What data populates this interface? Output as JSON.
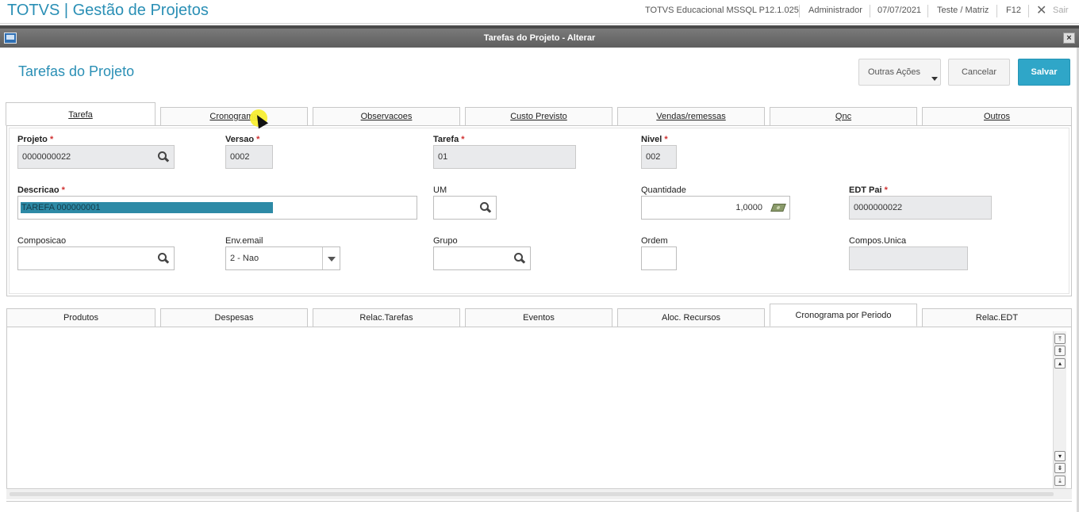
{
  "app": {
    "title": "TOTVS | Gestão de Projetos",
    "environment": "TOTVS Educacional MSSQL P12.1.025",
    "user": "Administrador",
    "date": "07/07/2021",
    "branch": "Teste / Matriz",
    "help_key": "F12",
    "exit_label": "Sair"
  },
  "window": {
    "title": "Tarefas do Projeto - Alterar",
    "close_glyph": "×"
  },
  "page": {
    "title": "Tarefas do Projeto"
  },
  "actions": {
    "more": "Outras Ações",
    "cancel": "Cancelar",
    "save": "Salvar"
  },
  "top_tabs": [
    "Tarefa",
    "Cronograma",
    "Observacoes",
    "Custo Previsto",
    "Vendas/remessas",
    "Qnc",
    "Outros"
  ],
  "form": {
    "projeto": {
      "label": "Projeto",
      "value": "0000000022"
    },
    "versao": {
      "label": "Versao",
      "value": "0002"
    },
    "tarefa": {
      "label": "Tarefa",
      "value": "01"
    },
    "nivel": {
      "label": "Nivel",
      "value": "002"
    },
    "descricao": {
      "label": "Descricao",
      "value": "TAREFA 000000001"
    },
    "um": {
      "label": "UM",
      "value": ""
    },
    "quantidade": {
      "label": "Quantidade",
      "value": "1,0000"
    },
    "edt_pai": {
      "label": "EDT Pai",
      "value": "0000000022"
    },
    "composicao": {
      "label": "Composicao",
      "value": ""
    },
    "env_email": {
      "label": "Env.email",
      "value": "2 - Nao"
    },
    "grupo": {
      "label": "Grupo",
      "value": ""
    },
    "ordem": {
      "label": "Ordem",
      "value": ""
    },
    "compos_unica": {
      "label": "Compos.Unica",
      "value": ""
    },
    "required_mark": "*"
  },
  "bottom_tabs": [
    "Produtos",
    "Despesas",
    "Relac.Tarefas",
    "Eventos",
    "Aloc. Recursos",
    "Cronograma por Periodo",
    "Relac.EDT"
  ],
  "colors": {
    "accent": "#2a8fb5",
    "save_button": "#2fa6c8",
    "required": "#d03030",
    "selection": "#2d8aa6"
  }
}
